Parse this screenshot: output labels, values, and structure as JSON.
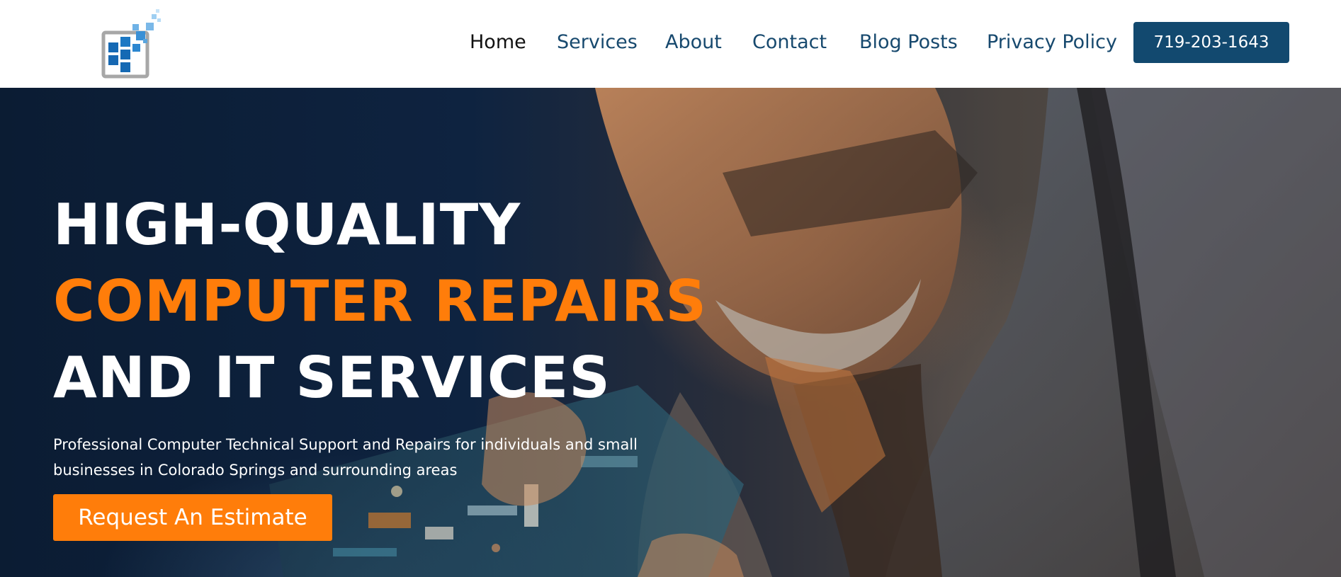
{
  "header": {
    "logo_icon": "pixel-square-logo-icon",
    "nav": {
      "home": "Home",
      "services": "Services",
      "about": "About",
      "contact": "Contact",
      "blog": "Blog Posts",
      "privacy": "Privacy Policy"
    },
    "phone": "719-203-1643"
  },
  "hero": {
    "headline_line1": "HIGH-QUALITY",
    "headline_line2": "COMPUTER REPAIRS",
    "headline_line3": "AND IT SERVICES",
    "subtext": "Professional Computer Technical Support and Repairs for individuals and small businesses in Colorado Springs and surrounding areas",
    "cta": "Request An Estimate",
    "background_image": "technician-repairing-circuit-board-photo"
  },
  "colors": {
    "brand_blue": "#12496f",
    "nav_text": "#17496e",
    "accent_orange": "#ff7d0a",
    "hero_dark": "#0b1c33"
  }
}
